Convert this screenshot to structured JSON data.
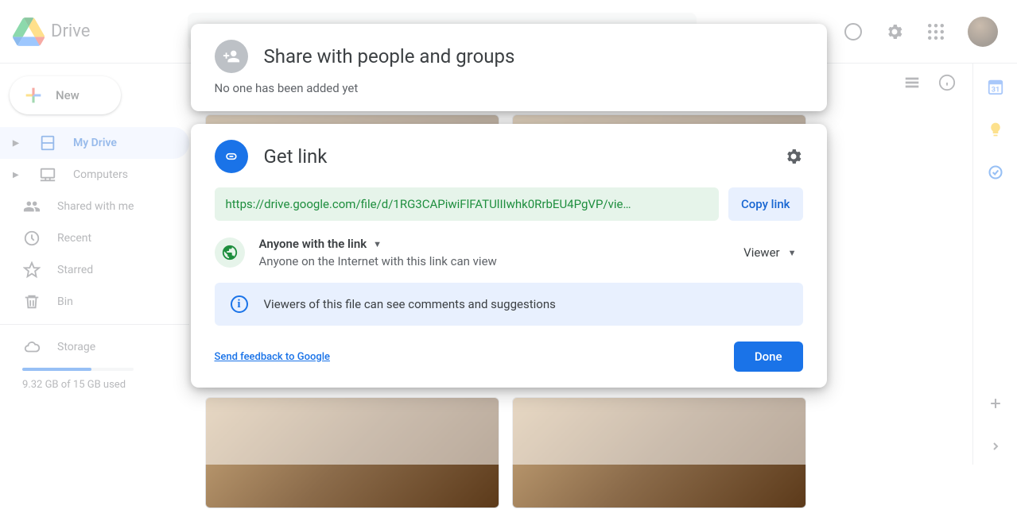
{
  "header": {
    "app_name": "Drive"
  },
  "sidebar": {
    "new_label": "New",
    "items": [
      "My Drive",
      "Computers",
      "Shared with me",
      "Recent",
      "Starred",
      "Bin"
    ],
    "storage_label": "Storage",
    "storage_used": "9.32 GB of 15 GB used"
  },
  "share_card": {
    "title": "Share with people and groups",
    "subtitle": "No one has been added yet"
  },
  "link_card": {
    "title": "Get link",
    "url": "https://drive.google.com/file/d/1RG3CAPiwiFlFATUlIIwhk0RrbEU4PgVP/vie…",
    "copy_label": "Copy link",
    "access_title": "Anyone with the link",
    "access_desc": "Anyone on the Internet with this link can view",
    "role": "Viewer",
    "info": "Viewers of this file can see comments and suggestions",
    "feedback": "Send feedback to Google",
    "done": "Done"
  }
}
